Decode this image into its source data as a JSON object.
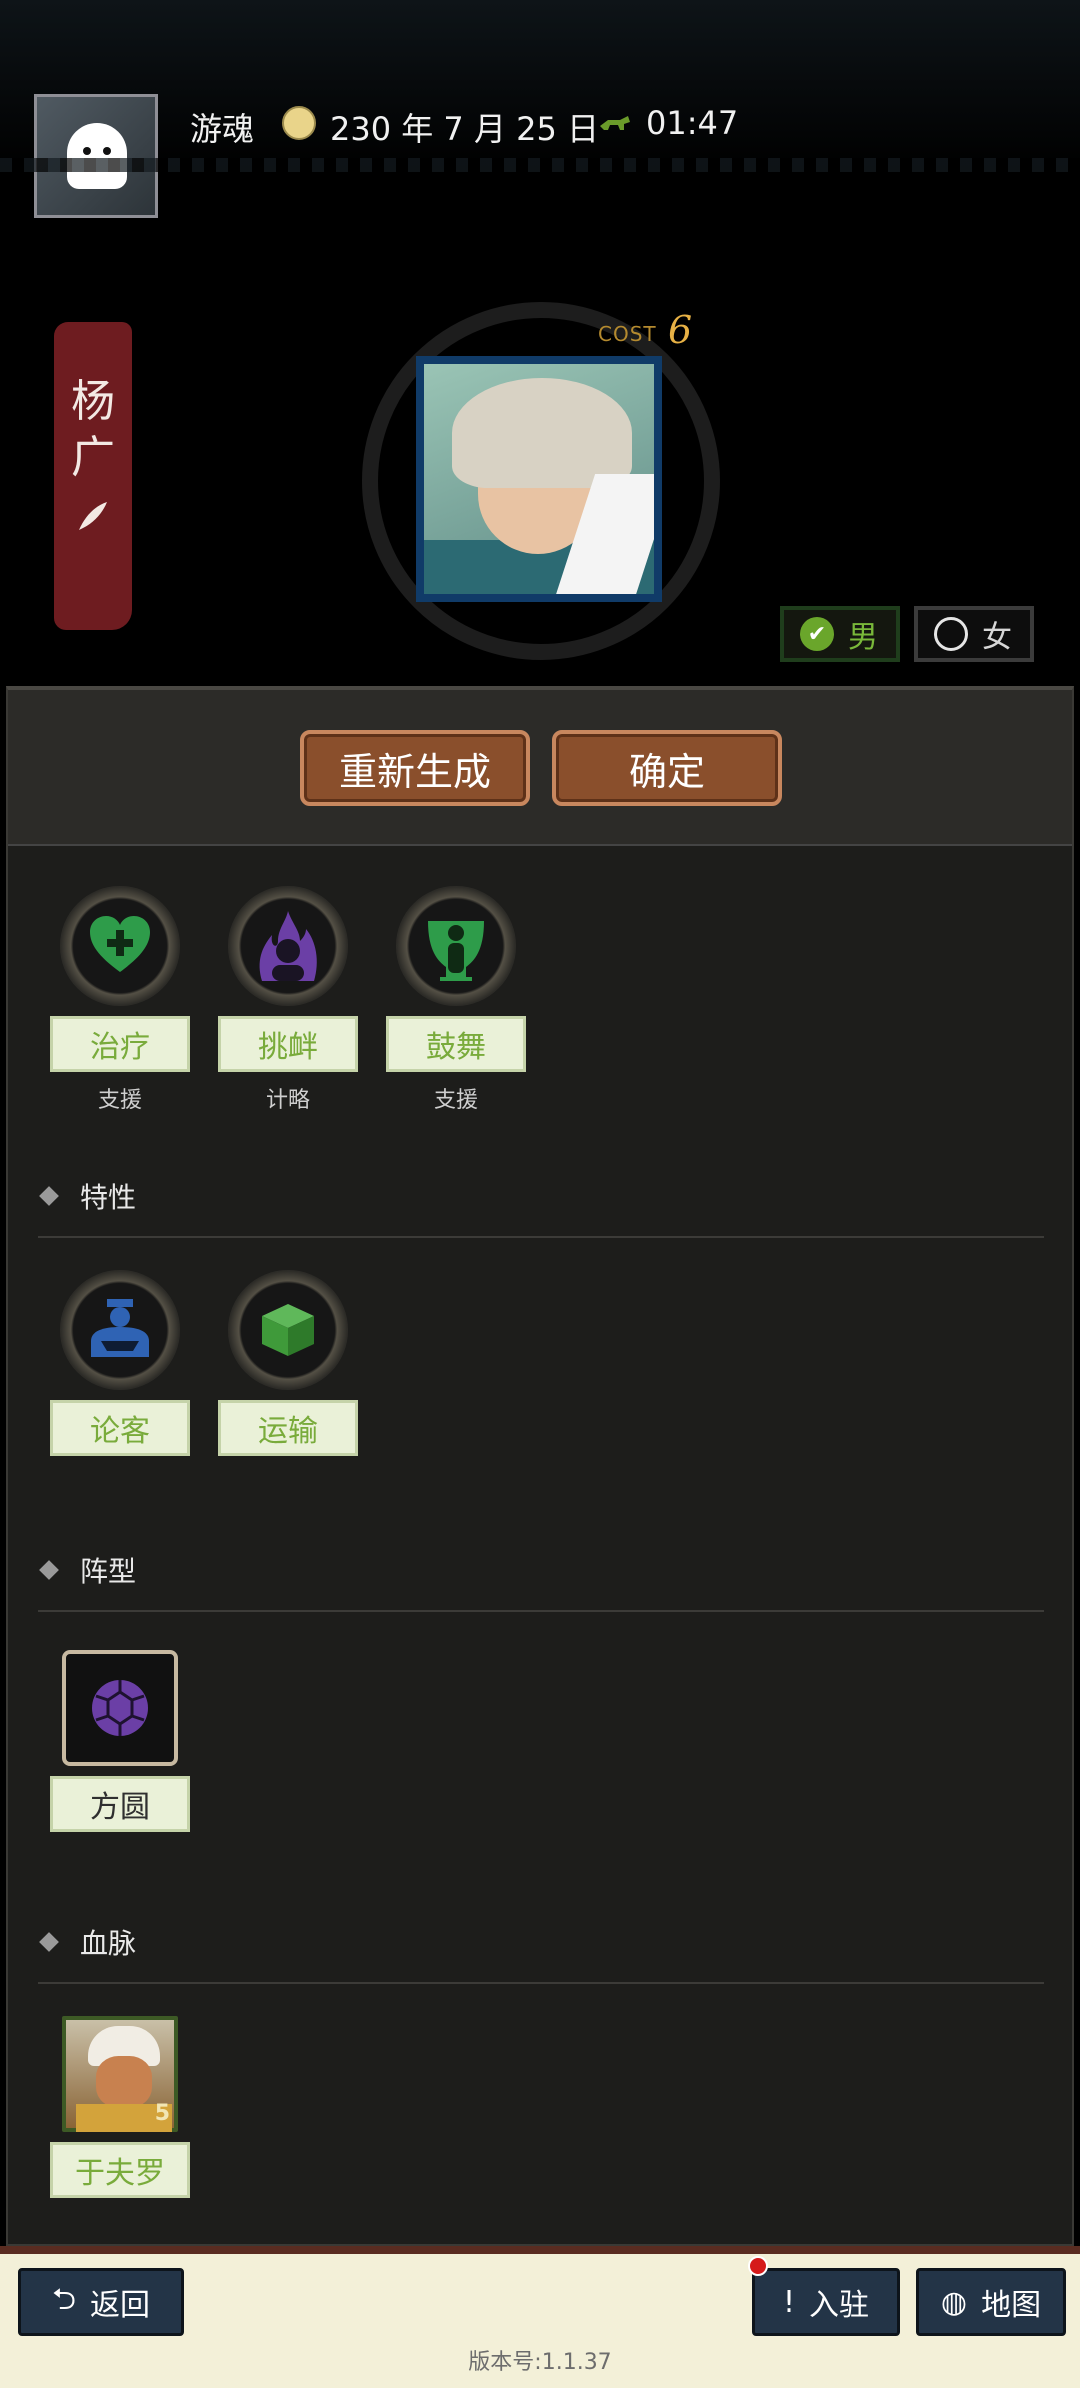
{
  "header": {
    "user_name": "游魂",
    "date": "230 年 7 月 25 日",
    "time": "01:47",
    "icons": [
      "ghost-avatar",
      "calendar-icon",
      "horse-clock-icon"
    ]
  },
  "character": {
    "name_line1": "杨",
    "name_line2": "广",
    "cost_label": "COST",
    "cost_value": "6",
    "gender_male": "男",
    "gender_female": "女",
    "selected_gender": "male"
  },
  "actions": {
    "regenerate": "重新生成",
    "confirm": "确定"
  },
  "skills": [
    {
      "label": "治疗",
      "type": "支援",
      "icon": "heal-heart-icon",
      "color": "#2e9c4a"
    },
    {
      "label": "挑衅",
      "type": "计略",
      "icon": "provoke-flame-icon",
      "color": "#6b3fa6"
    },
    {
      "label": "鼓舞",
      "type": "支援",
      "icon": "inspire-person-icon",
      "color": "#2e9c4a"
    }
  ],
  "traits": {
    "title": "特性",
    "items": [
      {
        "label": "论客",
        "icon": "debater-icon",
        "color": "#2f63b4"
      },
      {
        "label": "运输",
        "icon": "transport-box-icon",
        "color": "#3f9a3a"
      }
    ]
  },
  "formation": {
    "title": "阵型",
    "items": [
      {
        "label": "方圆",
        "icon": "turtle-shell-icon",
        "color": "#6b3fa6"
      }
    ]
  },
  "bloodline": {
    "title": "血脉",
    "items": [
      {
        "label": "于夫罗",
        "level": "5",
        "icon": "bloodline-portrait"
      }
    ]
  },
  "footer": {
    "back": "返回",
    "settle": "入驻",
    "map": "地图",
    "version": "版本号:1.1.37"
  }
}
